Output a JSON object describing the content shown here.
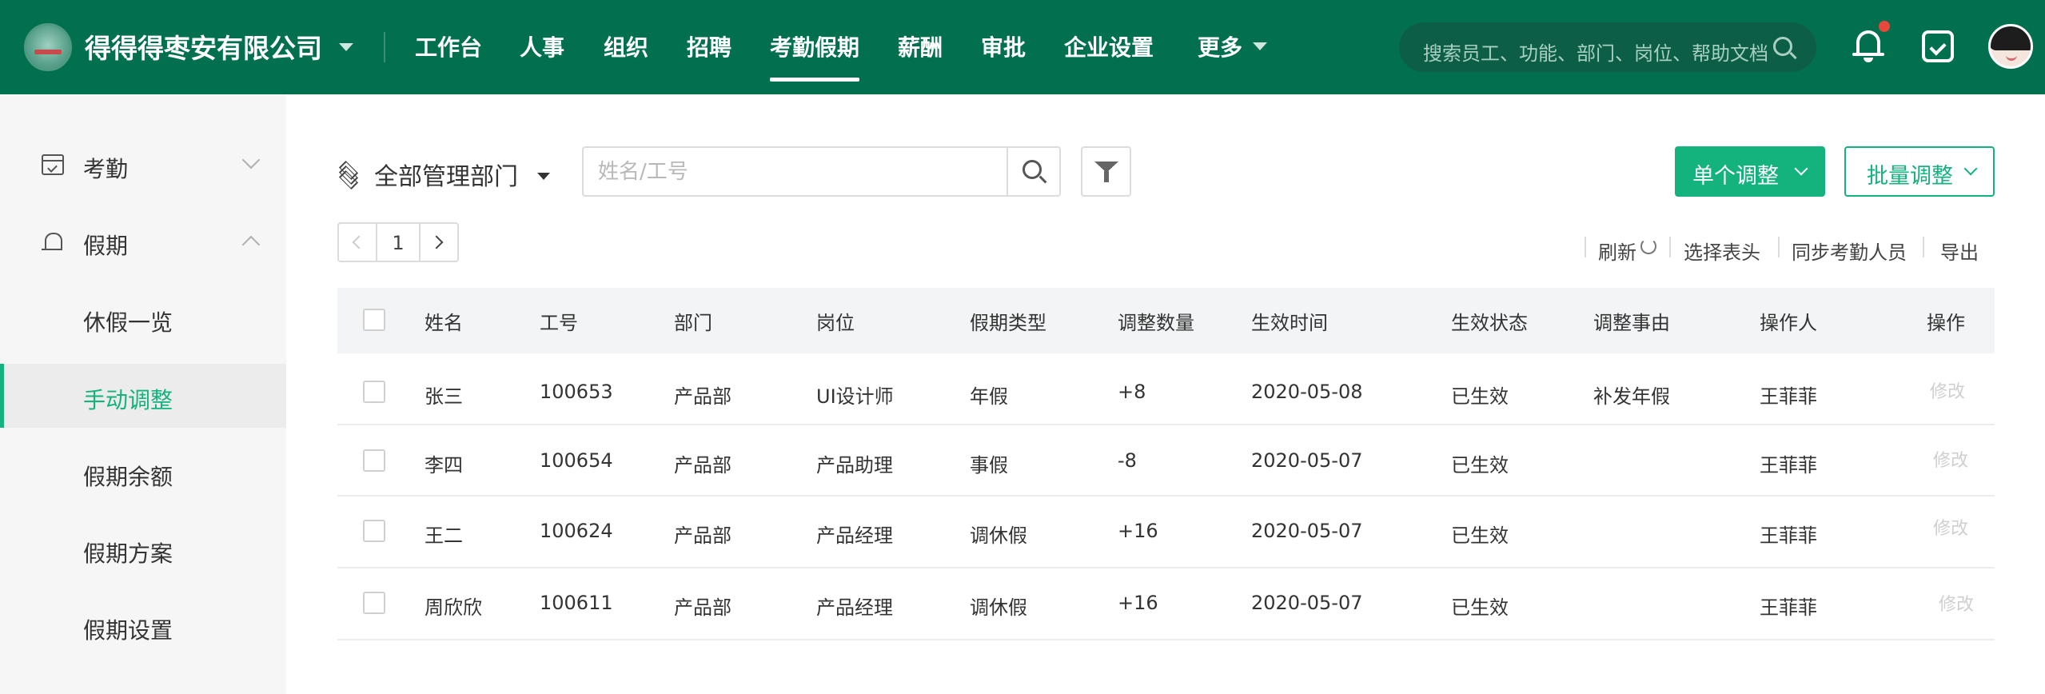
{
  "header": {
    "company": "得得得枣安有限公司",
    "nav": [
      {
        "label": "工作台"
      },
      {
        "label": "人事"
      },
      {
        "label": "组织"
      },
      {
        "label": "招聘"
      },
      {
        "label": "考勤假期",
        "active": true
      },
      {
        "label": "薪酬"
      },
      {
        "label": "审批"
      },
      {
        "label": "企业设置"
      },
      {
        "label": "更多"
      }
    ],
    "search_placeholder": "搜索员工、功能、部门、岗位、帮助文档",
    "colors": {
      "bar": "#02704e",
      "accent": "#14b27d",
      "badge": "#e8473b"
    },
    "icons": [
      "search-icon",
      "bell-icon",
      "message-icon",
      "avatar"
    ]
  },
  "sidebar": {
    "groups": [
      {
        "label": "考勤",
        "icon": "calendar-icon",
        "expanded": false
      },
      {
        "label": "假期",
        "icon": "umbrella-icon",
        "expanded": true
      }
    ],
    "sub_items": [
      {
        "label": "休假一览"
      },
      {
        "label": "手动调整",
        "active": true
      },
      {
        "label": "假期余额"
      },
      {
        "label": "假期方案"
      },
      {
        "label": "假期设置"
      }
    ]
  },
  "toolbar": {
    "department": "全部管理部门",
    "search_placeholder": "姓名/工号",
    "single_adjust": "单个调整",
    "batch_adjust": "批量调整"
  },
  "pagination": {
    "current": "1"
  },
  "actions": {
    "refresh": "刷新",
    "choose_columns": "选择表头",
    "sync": "同步考勤人员",
    "export": "导出"
  },
  "table": {
    "columns": [
      "姓名",
      "工号",
      "部门",
      "岗位",
      "假期类型",
      "调整数量",
      "生效时间",
      "生效状态",
      "调整事由",
      "操作人",
      "操作"
    ],
    "rows": [
      {
        "name": "张三",
        "id": "100653",
        "dept": "产品部",
        "post": "UI设计师",
        "type": "年假",
        "amount": "+8",
        "date": "2020-05-08",
        "status": "已生效",
        "reason": "补发年假",
        "operator": "王菲菲",
        "action": "修改"
      },
      {
        "name": "李四",
        "id": "100654",
        "dept": "产品部",
        "post": "产品助理",
        "type": "事假",
        "amount": "-8",
        "date": "2020-05-07",
        "status": "已生效",
        "reason": "",
        "operator": "王菲菲",
        "action": "修改"
      },
      {
        "name": "王二",
        "id": "100624",
        "dept": "产品部",
        "post": "产品经理",
        "type": "调休假",
        "amount": "+16",
        "date": "2020-05-07",
        "status": "已生效",
        "reason": "",
        "operator": "王菲菲",
        "action": "修改"
      },
      {
        "name": "周欣欣",
        "id": "100611",
        "dept": "产品部",
        "post": "产品经理",
        "type": "调休假",
        "amount": "+16",
        "date": "2020-05-07",
        "status": "已生效",
        "reason": "",
        "operator": "王菲菲",
        "action": "修改"
      }
    ]
  }
}
